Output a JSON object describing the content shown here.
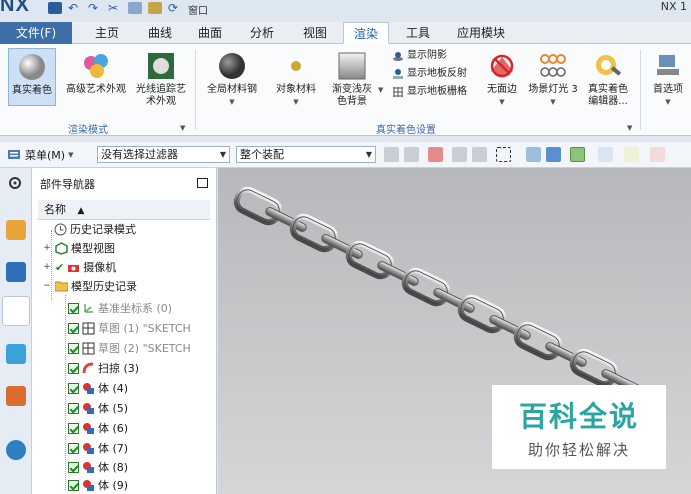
{
  "titlebar": {
    "logo": "NX",
    "window_menu": "窗口",
    "version_label": "NX 1"
  },
  "menu_tabs": [
    {
      "label": "文件(F)"
    },
    {
      "label": "主页"
    },
    {
      "label": "曲线"
    },
    {
      "label": "曲面"
    },
    {
      "label": "分析"
    },
    {
      "label": "视图"
    },
    {
      "label": "渲染"
    },
    {
      "label": "工具"
    },
    {
      "label": "应用模块"
    }
  ],
  "active_tab": "渲染",
  "ribbon": {
    "render_mode": {
      "group_label": "渲染模式",
      "buttons": [
        "真实着色",
        "高级艺术外观",
        "光线追踪艺术外观"
      ]
    },
    "true_shading": {
      "group_label": "真实着色设置",
      "buttons": [
        "全局材料钢",
        "对象材料",
        "渐变浅灰色背景"
      ],
      "small_buttons": [
        "显示阴影",
        "显示地板反射",
        "显示地板栅格"
      ],
      "more_buttons": [
        "无面边",
        "场景灯光 3",
        "真实着色编辑器..."
      ]
    },
    "preferences_button": "首选项"
  },
  "toolbar": {
    "menu_label": "菜单(M)",
    "selection_filter": "没有选择过滤器",
    "assembly_scope": "整个装配"
  },
  "navigator": {
    "title": "部件导航器",
    "column_header": "名称",
    "items": [
      {
        "label": "历史记录模式",
        "icon": "clock-icon"
      },
      {
        "label": "模型视图",
        "icon": "views-icon"
      },
      {
        "label": "摄像机",
        "icon": "camera-icon"
      },
      {
        "label": "模型历史记录",
        "icon": "folder-icon"
      },
      {
        "label": "基准坐标系 (0)",
        "icon": "csys-icon"
      },
      {
        "label": "草图 (1) \"SKETCH",
        "icon": "sketch-icon"
      },
      {
        "label": "草图 (2) \"SKETCH",
        "icon": "sketch-icon"
      },
      {
        "label": "扫掠 (3)",
        "icon": "sweep-icon"
      },
      {
        "label": "体 (4)",
        "icon": "body-icon"
      },
      {
        "label": "体 (5)",
        "icon": "body-icon"
      },
      {
        "label": "体 (6)",
        "icon": "body-icon"
      },
      {
        "label": "体 (7)",
        "icon": "body-icon"
      },
      {
        "label": "体 (8)",
        "icon": "body-icon"
      },
      {
        "label": "体 (9)",
        "icon": "body-icon"
      }
    ]
  },
  "watermark": {
    "title": "百科全说",
    "subtitle": "助你轻松解决"
  },
  "colors": {
    "accent": "#3d6ea8",
    "ribbon_group_label": "#3c6aa8",
    "watermark": "#2aa5a1"
  }
}
